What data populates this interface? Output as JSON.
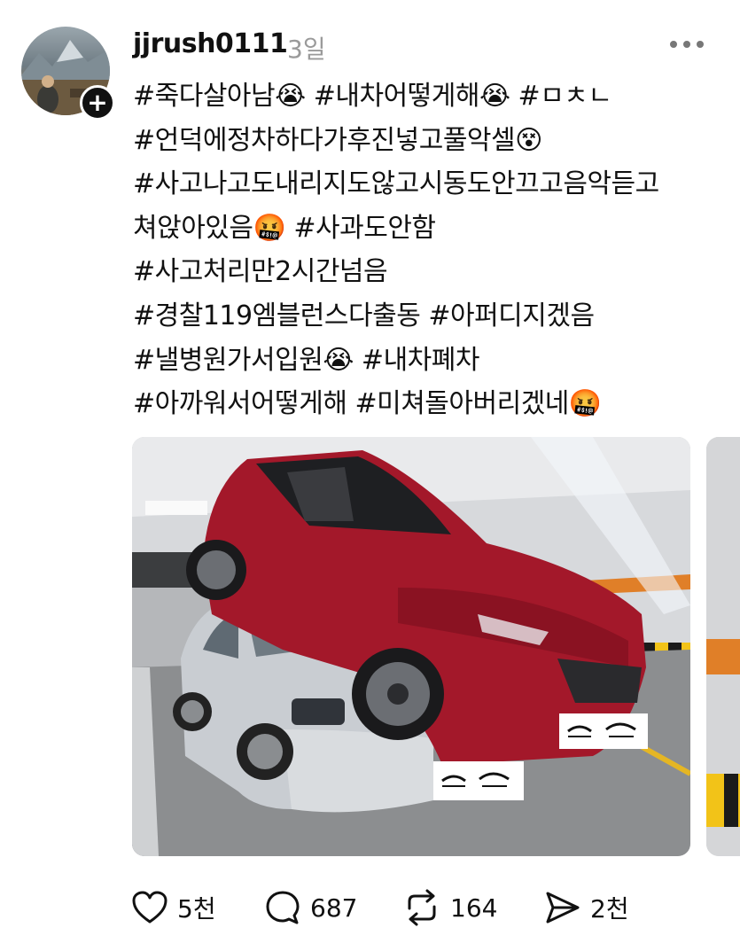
{
  "post": {
    "username": "jjrush0111",
    "timestamp": "3일",
    "text_lines": [
      "#죽다살아남😭 #내차어떻게해😭 #ㅁㅊㄴ",
      "#언덕에정차하다가후진넣고풀악셀😵",
      "#사고나고도내리지도않고시동도안끄고음악듣고",
      "쳐앉아있음🤬 #사과도안함",
      "#사고처리만2시간넘음",
      "#경찰119엠블런스다출동 #아퍼디지겠음",
      "#낼병원가서입원😭 #내차폐차",
      "#아까워서어떻게해 #미쳐돌아버리겠네🤬"
    ]
  },
  "actions": {
    "likes": "5천",
    "comments": "687",
    "reposts": "164",
    "shares": "2천"
  },
  "icons": {
    "avatar": "profile-avatar",
    "follow": "plus-icon",
    "more": "more-dots-icon",
    "like": "heart-icon",
    "comment": "comment-bubble-icon",
    "repost": "repost-icon",
    "share": "send-icon"
  },
  "colors": {
    "text": "#111111",
    "muted": "#9a9a9a",
    "car_red": "#a3182a",
    "car_silver": "#c9cdd2"
  }
}
